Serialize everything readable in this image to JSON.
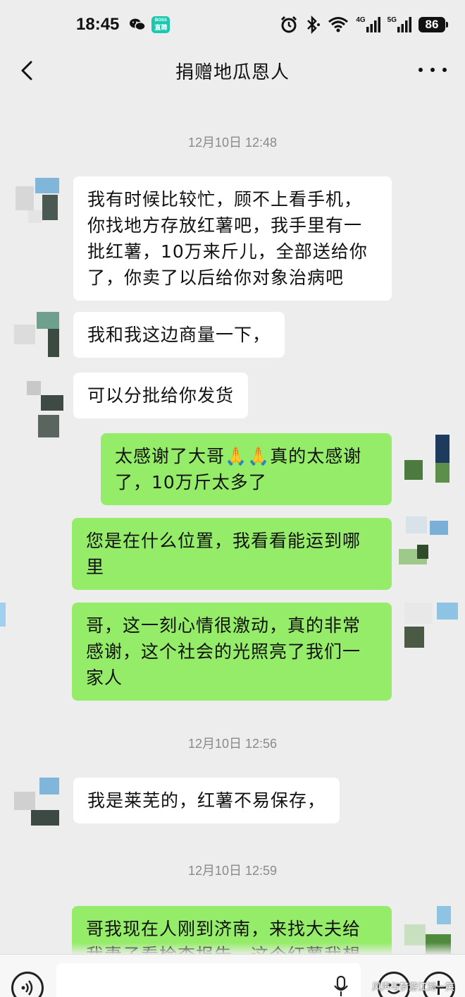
{
  "status_bar": {
    "time": "18:45",
    "boss_badge_top": "BOSS",
    "boss_badge_bottom": "直聘",
    "network_1": "4G",
    "network_2": "5G",
    "battery": "86"
  },
  "header": {
    "title": "捐赠地瓜恩人"
  },
  "messages": [
    {
      "type": "time",
      "text": "12月10日 12:48"
    },
    {
      "type": "in",
      "text": "我有时候比较忙，顾不上看手机，\n你找地方存放红薯吧，我手里有一\n批红薯，10万来斤儿，全部送给你\n了，你卖了以后给你对象治病吧"
    },
    {
      "type": "in",
      "text": "我和我这边商量一下，"
    },
    {
      "type": "in",
      "text": "可以分批给你发货"
    },
    {
      "type": "out",
      "text": "太感谢了大哥🙏🙏真的太感谢\n了，10万斤太多了"
    },
    {
      "type": "out",
      "text": "您是在什么位置，我看看能运到哪\n里"
    },
    {
      "type": "out",
      "text": "哥，这一刻心情很激动，真的非常\n感谢，这个社会的光照亮了我们一\n家人"
    },
    {
      "type": "time",
      "text": "12月10日 12:56"
    },
    {
      "type": "in",
      "text": "我是莱芜的，红薯不易保存，"
    },
    {
      "type": "time",
      "text": "12月10日 12:59"
    },
    {
      "type": "out",
      "text": "哥我现在人刚到济南，来找大夫给\n我妻子看检查报告，这个红薯我想"
    }
  ],
  "input_bar": {
    "placeholder": ""
  },
  "watermark": "风声与梦游江湖一笑",
  "colors": {
    "background": "#ededed",
    "incoming_bubble": "#ffffff",
    "outgoing_bubble": "#95ec69"
  },
  "icons": [
    "back-arrow-icon",
    "more-dots-icon",
    "voice-icon",
    "mic-icon",
    "emoji-icon",
    "plus-icon",
    "wechat-icon",
    "alarm-icon",
    "bluetooth-icon",
    "wifi-icon",
    "signal-icon"
  ]
}
